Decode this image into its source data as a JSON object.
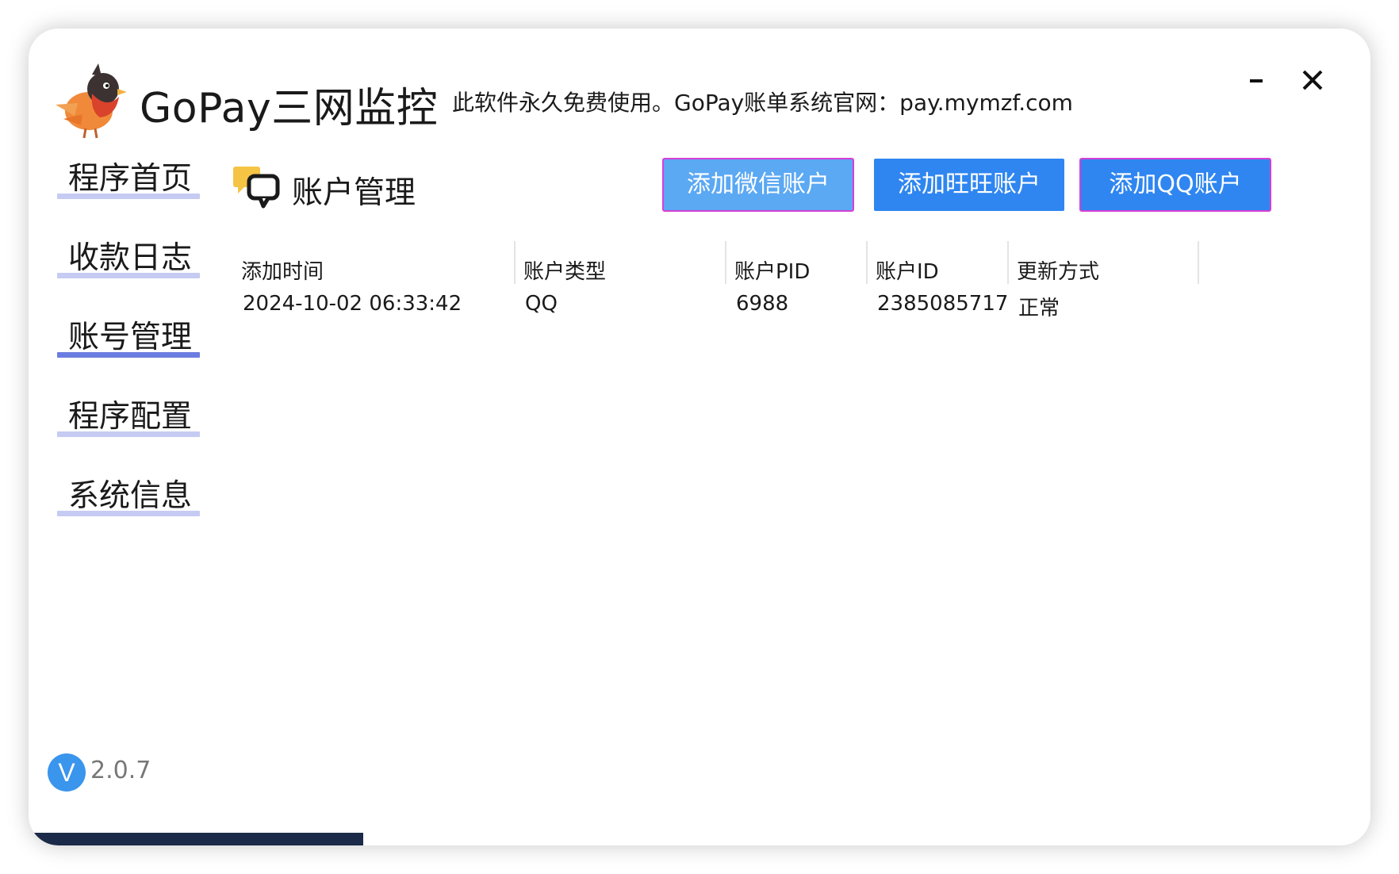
{
  "header": {
    "app_title": "GoPay三网监控",
    "notice": "此软件永久免费使用。GoPay账单系统官网：pay.mymzf.com",
    "minimize_glyph": "–",
    "close_glyph": "✕"
  },
  "sidebar": {
    "items": [
      {
        "label": "程序首页",
        "active": false
      },
      {
        "label": "收款日志",
        "active": false
      },
      {
        "label": "账号管理",
        "active": true
      },
      {
        "label": "程序配置",
        "active": false
      },
      {
        "label": "系统信息",
        "active": false
      }
    ]
  },
  "main": {
    "section_title": "账户管理",
    "section_icon": "chat-bubbles-icon",
    "buttons": {
      "add_wechat": "添加微信账户",
      "add_wangwang": "添加旺旺账户",
      "add_qq": "添加QQ账户"
    },
    "table": {
      "headers": [
        "添加时间",
        "账户类型",
        "账户PID",
        "账户ID",
        "更新方式"
      ],
      "rows": [
        [
          "2024-10-02 06:33:42",
          "QQ",
          "6988",
          "2385085717",
          "正常"
        ]
      ]
    }
  },
  "footer": {
    "version_badge": "V",
    "version": "2.0.7"
  },
  "colors": {
    "accent_blue": "#2f86f0",
    "nav_underline": "#c5cbf2",
    "nav_underline_active": "#6b7de0",
    "version_badge": "#3a95ec"
  }
}
